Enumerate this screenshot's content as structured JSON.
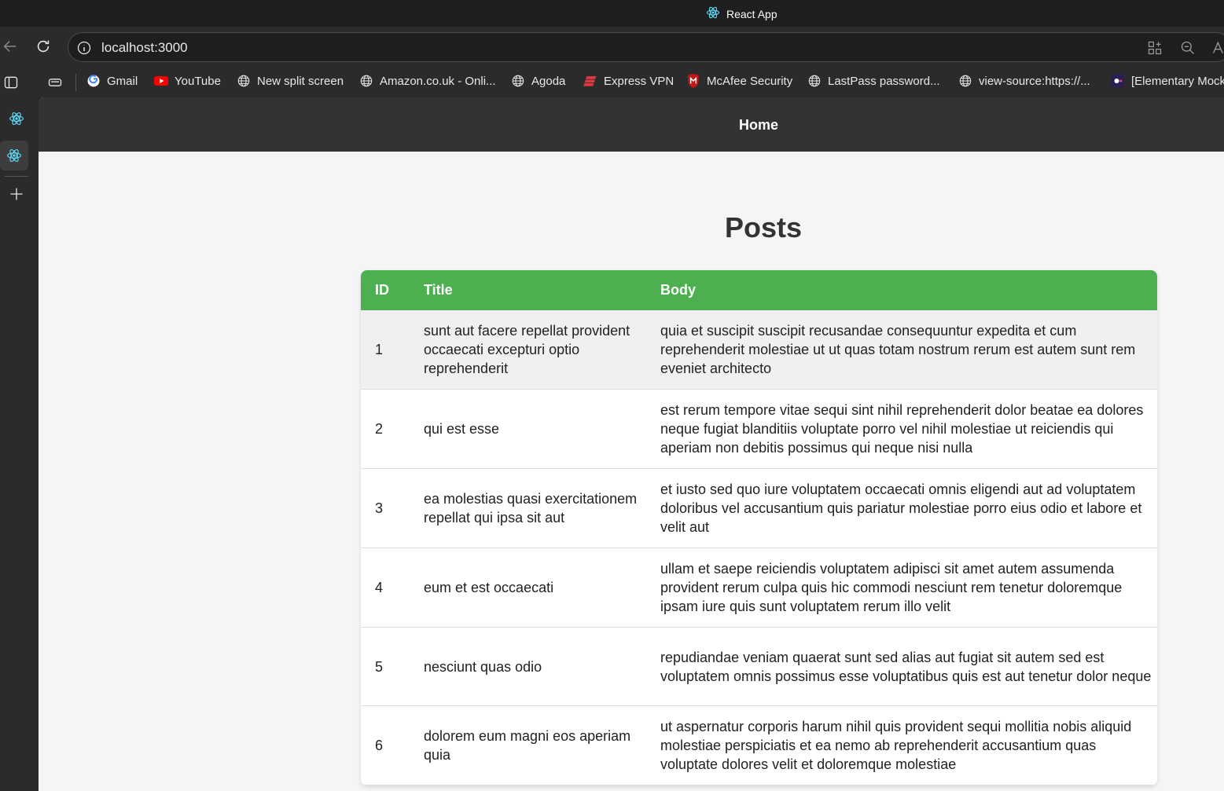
{
  "browser": {
    "tab_title": "React App",
    "url": "localhost:3000"
  },
  "bookmarks": [
    {
      "label": "Gmail",
      "icon": "google-icon"
    },
    {
      "label": "YouTube",
      "icon": "youtube-icon"
    },
    {
      "label": "New split screen",
      "icon": "globe-icon"
    },
    {
      "label": "Amazon.co.uk - Onli...",
      "icon": "globe-icon"
    },
    {
      "label": "Agoda",
      "icon": "globe-icon"
    },
    {
      "label": "Express VPN",
      "icon": "expressvpn-icon"
    },
    {
      "label": "McAfee Security",
      "icon": "mcafee-icon"
    },
    {
      "label": "LastPass password...",
      "icon": "globe-icon"
    },
    {
      "label": "view-source:https://...",
      "icon": "globe-icon"
    },
    {
      "label": "[Elementary Mock",
      "icon": "app-icon"
    }
  ],
  "app": {
    "nav_home": "Home",
    "heading": "Posts",
    "columns": [
      "ID",
      "Title",
      "Body"
    ],
    "rows": [
      {
        "id": "1",
        "title": "sunt aut facere repellat provident occaecati excepturi optio reprehenderit",
        "body": "quia et suscipit suscipit recusandae consequuntur expedita et cum reprehenderit molestiae ut ut quas totam nostrum rerum est autem sunt rem eveniet architecto"
      },
      {
        "id": "2",
        "title": "qui est esse",
        "body": "est rerum tempore vitae sequi sint nihil reprehenderit dolor beatae ea dolores neque fugiat blanditiis voluptate porro vel nihil molestiae ut reiciendis qui aperiam non debitis possimus qui neque nisi nulla"
      },
      {
        "id": "3",
        "title": "ea molestias quasi exercitationem repellat qui ipsa sit aut",
        "body": "et iusto sed quo iure voluptatem occaecati omnis eligendi aut ad voluptatem doloribus vel accusantium quis pariatur molestiae porro eius odio et labore et velit aut"
      },
      {
        "id": "4",
        "title": "eum et est occaecati",
        "body": "ullam et saepe reiciendis voluptatem adipisci sit amet autem assumenda provident rerum culpa quis hic commodi nesciunt rem tenetur doloremque ipsam iure quis sunt voluptatem rerum illo velit"
      },
      {
        "id": "5",
        "title": "nesciunt quas odio",
        "body": "repudiandae veniam quaerat sunt sed alias aut fugiat sit autem sed est voluptatem omnis possimus esse voluptatibus quis est aut tenetur dolor neque"
      },
      {
        "id": "6",
        "title": "dolorem eum magni eos aperiam quia",
        "body": "ut aspernatur corporis harum nihil quis provident sequi mollitia nobis aliquid molestiae perspiciatis et ea nemo ab reprehenderit accusantium quas voluptate dolores velit et doloremque molestiae"
      }
    ]
  },
  "colors": {
    "table_header": "#4caf50",
    "app_nav": "#333333",
    "page_bg": "#f4f5f7",
    "hover_row": "#f0f0f0"
  }
}
